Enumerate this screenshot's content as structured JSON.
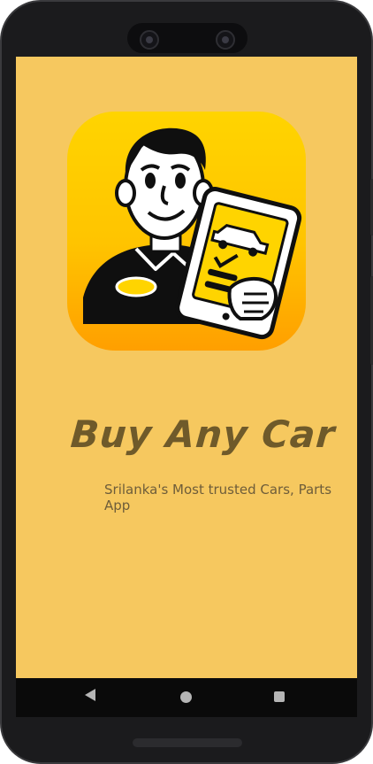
{
  "app": {
    "title": "Buy Any Car",
    "tagline": "Srilanka's Most trusted Cars, Parts App"
  },
  "logo": {
    "icon": "dealer-with-tablet-icon"
  },
  "colors": {
    "screen_background": "#f6c85f",
    "title_color": "#6f5a2a",
    "subtitle_color": "#6e5d3a",
    "logo_gradient_top": "#ffd400",
    "logo_gradient_bottom": "#ff9f00"
  },
  "navigation": {
    "back_icon": "back-icon",
    "home_icon": "home-icon",
    "recent_icon": "recent-apps-icon"
  }
}
